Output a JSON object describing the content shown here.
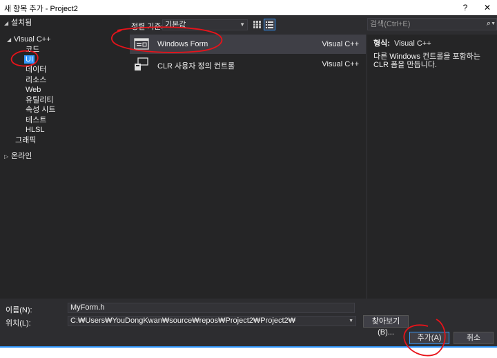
{
  "window": {
    "title": "새 항목 추가 - Project2",
    "help_label": "?",
    "close_label": "✕"
  },
  "tree": {
    "items": [
      {
        "label": "설치됨",
        "arrow": "◢"
      },
      {
        "label": "Visual C++",
        "arrow": "◢"
      },
      {
        "label": "코드",
        "arrow": ""
      },
      {
        "label": "UI",
        "arrow": ""
      },
      {
        "label": "데이터",
        "arrow": ""
      },
      {
        "label": "리소스",
        "arrow": ""
      },
      {
        "label": "Web",
        "arrow": ""
      },
      {
        "label": "유틸리티",
        "arrow": ""
      },
      {
        "label": "속성 시트",
        "arrow": ""
      },
      {
        "label": "테스트",
        "arrow": ""
      },
      {
        "label": "HLSL",
        "arrow": ""
      },
      {
        "label": "그래픽",
        "arrow": ""
      },
      {
        "label": "온라인",
        "arrow": "▷"
      }
    ]
  },
  "toolbar": {
    "sort_label": "정렬 기준:",
    "sort_value": "기본값"
  },
  "search": {
    "placeholder": "검색(Ctrl+E)"
  },
  "templates": [
    {
      "name": "Windows Form",
      "type": "Visual C++",
      "icon": "form-icon"
    },
    {
      "name": "CLR 사용자 정의 컨트롤",
      "type": "Visual C++",
      "icon": "custom-control-icon"
    }
  ],
  "info": {
    "type_label": "형식:",
    "type_value": "Visual C++",
    "description": "다른 Windows 컨트롤을 포함하는 CLR 폼을 만듭니다."
  },
  "form": {
    "name_label": "이름(N):",
    "name_value": "MyForm.h",
    "location_label": "위치(L):",
    "location_value": "C:₩Users₩YouDongKwan₩source₩repos₩Project2₩Project2₩",
    "browse_label": "찾아보기(B)...",
    "add_label": "추가(A)",
    "cancel_label": "취소"
  },
  "colors": {
    "accent": "#3399ff",
    "annotation": "#e8131a"
  }
}
